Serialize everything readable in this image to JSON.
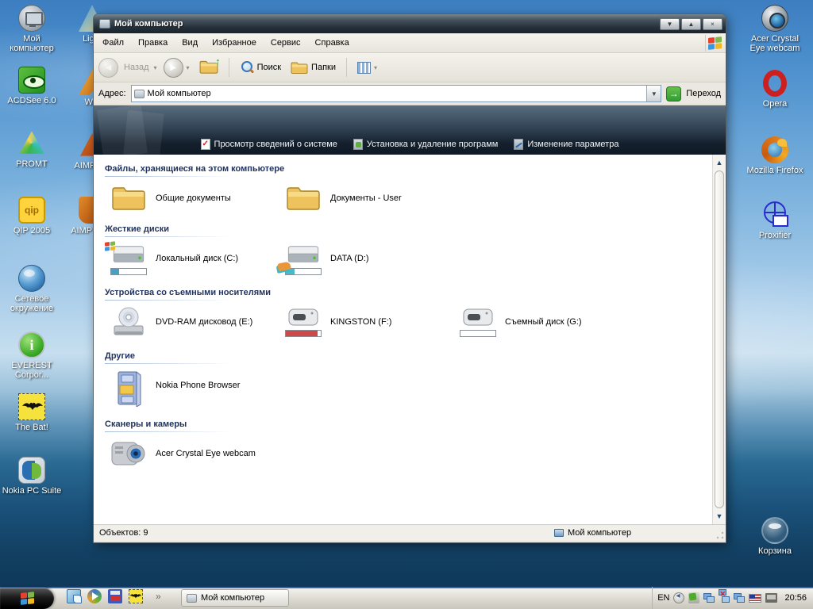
{
  "icons": {
    "minimize_glyph": "▼",
    "maximize_glyph": "▲",
    "close_glyph": "×",
    "dropdown_glyph": "▼",
    "caret_glyph": "▾",
    "back_glyph": "◀",
    "forward_glyph": "▶",
    "up_glyph": "↑",
    "go_glyph": "→",
    "chevron_glyph": "»",
    "scroll_up_glyph": "▲",
    "scroll_down_glyph": "▼"
  },
  "colors": {
    "usage_blue": "#4aa0c4",
    "usage_cyan": "#45bccc",
    "usage_red": "#cc4a48",
    "usage_empty": "#ffffff"
  },
  "desktop": {
    "left_icons": [
      "Мой компьютер",
      "ACDSee 6.0",
      "PROMT",
      "QIP 2005",
      "Сетевое окружение",
      "EVEREST Corpor...",
      "The Bat!",
      "Nokia PC Suite"
    ],
    "second_column_icons": [
      "Light",
      "Win",
      "AIMP PR",
      "AIMP PRO"
    ],
    "right_icons": [
      "Acer Crystal Eye webcam",
      "Opera",
      "Mozilla Firefox",
      "Proxifier",
      "Корзина"
    ]
  },
  "window": {
    "title": "Мой компьютер",
    "menu": [
      "Файл",
      "Правка",
      "Вид",
      "Избранное",
      "Сервис",
      "Справка"
    ],
    "toolbar": {
      "back_label": "Назад",
      "search_label": "Поиск",
      "folders_label": "Папки"
    },
    "address": {
      "label": "Адрес:",
      "value": "Мой компьютер",
      "go_label": "Переход"
    },
    "banner_links": [
      "Просмотр сведений о системе",
      "Установка и удаление программ",
      "Изменение параметра"
    ],
    "sections": [
      {
        "title": "Файлы, хранящиеся на этом компьютере",
        "items": [
          {
            "label": "Общие документы"
          },
          {
            "label": "Документы - User"
          }
        ]
      },
      {
        "title": "Жесткие диски",
        "items": [
          {
            "label": "Локальный диск (C:)",
            "usage_width": "22%",
            "usage_color": "#4aa0c4"
          },
          {
            "label": "DATA (D:)",
            "usage_width": "26%",
            "usage_color": "#45bccc"
          }
        ]
      },
      {
        "title": "Устройства со съемными носителями",
        "items": [
          {
            "label": "DVD-RAM дисковод (E:)"
          },
          {
            "label": "KINGSTON (F:)",
            "usage_width": "90%",
            "usage_color": "#cc4a48"
          },
          {
            "label": "Съемный диск (G:)",
            "usage_width": "0%",
            "usage_color": "#ffffff"
          }
        ]
      },
      {
        "title": "Другие",
        "items": [
          {
            "label": "Nokia Phone Browser"
          }
        ]
      },
      {
        "title": "Сканеры и камеры",
        "items": [
          {
            "label": "Acer Crystal Eye webcam"
          }
        ]
      }
    ],
    "status": {
      "objects": "Объектов: 9",
      "location": "Мой компьютер"
    }
  },
  "taskbar": {
    "task_button_label": "Мой компьютер",
    "language": "EN",
    "time": "20:56"
  }
}
